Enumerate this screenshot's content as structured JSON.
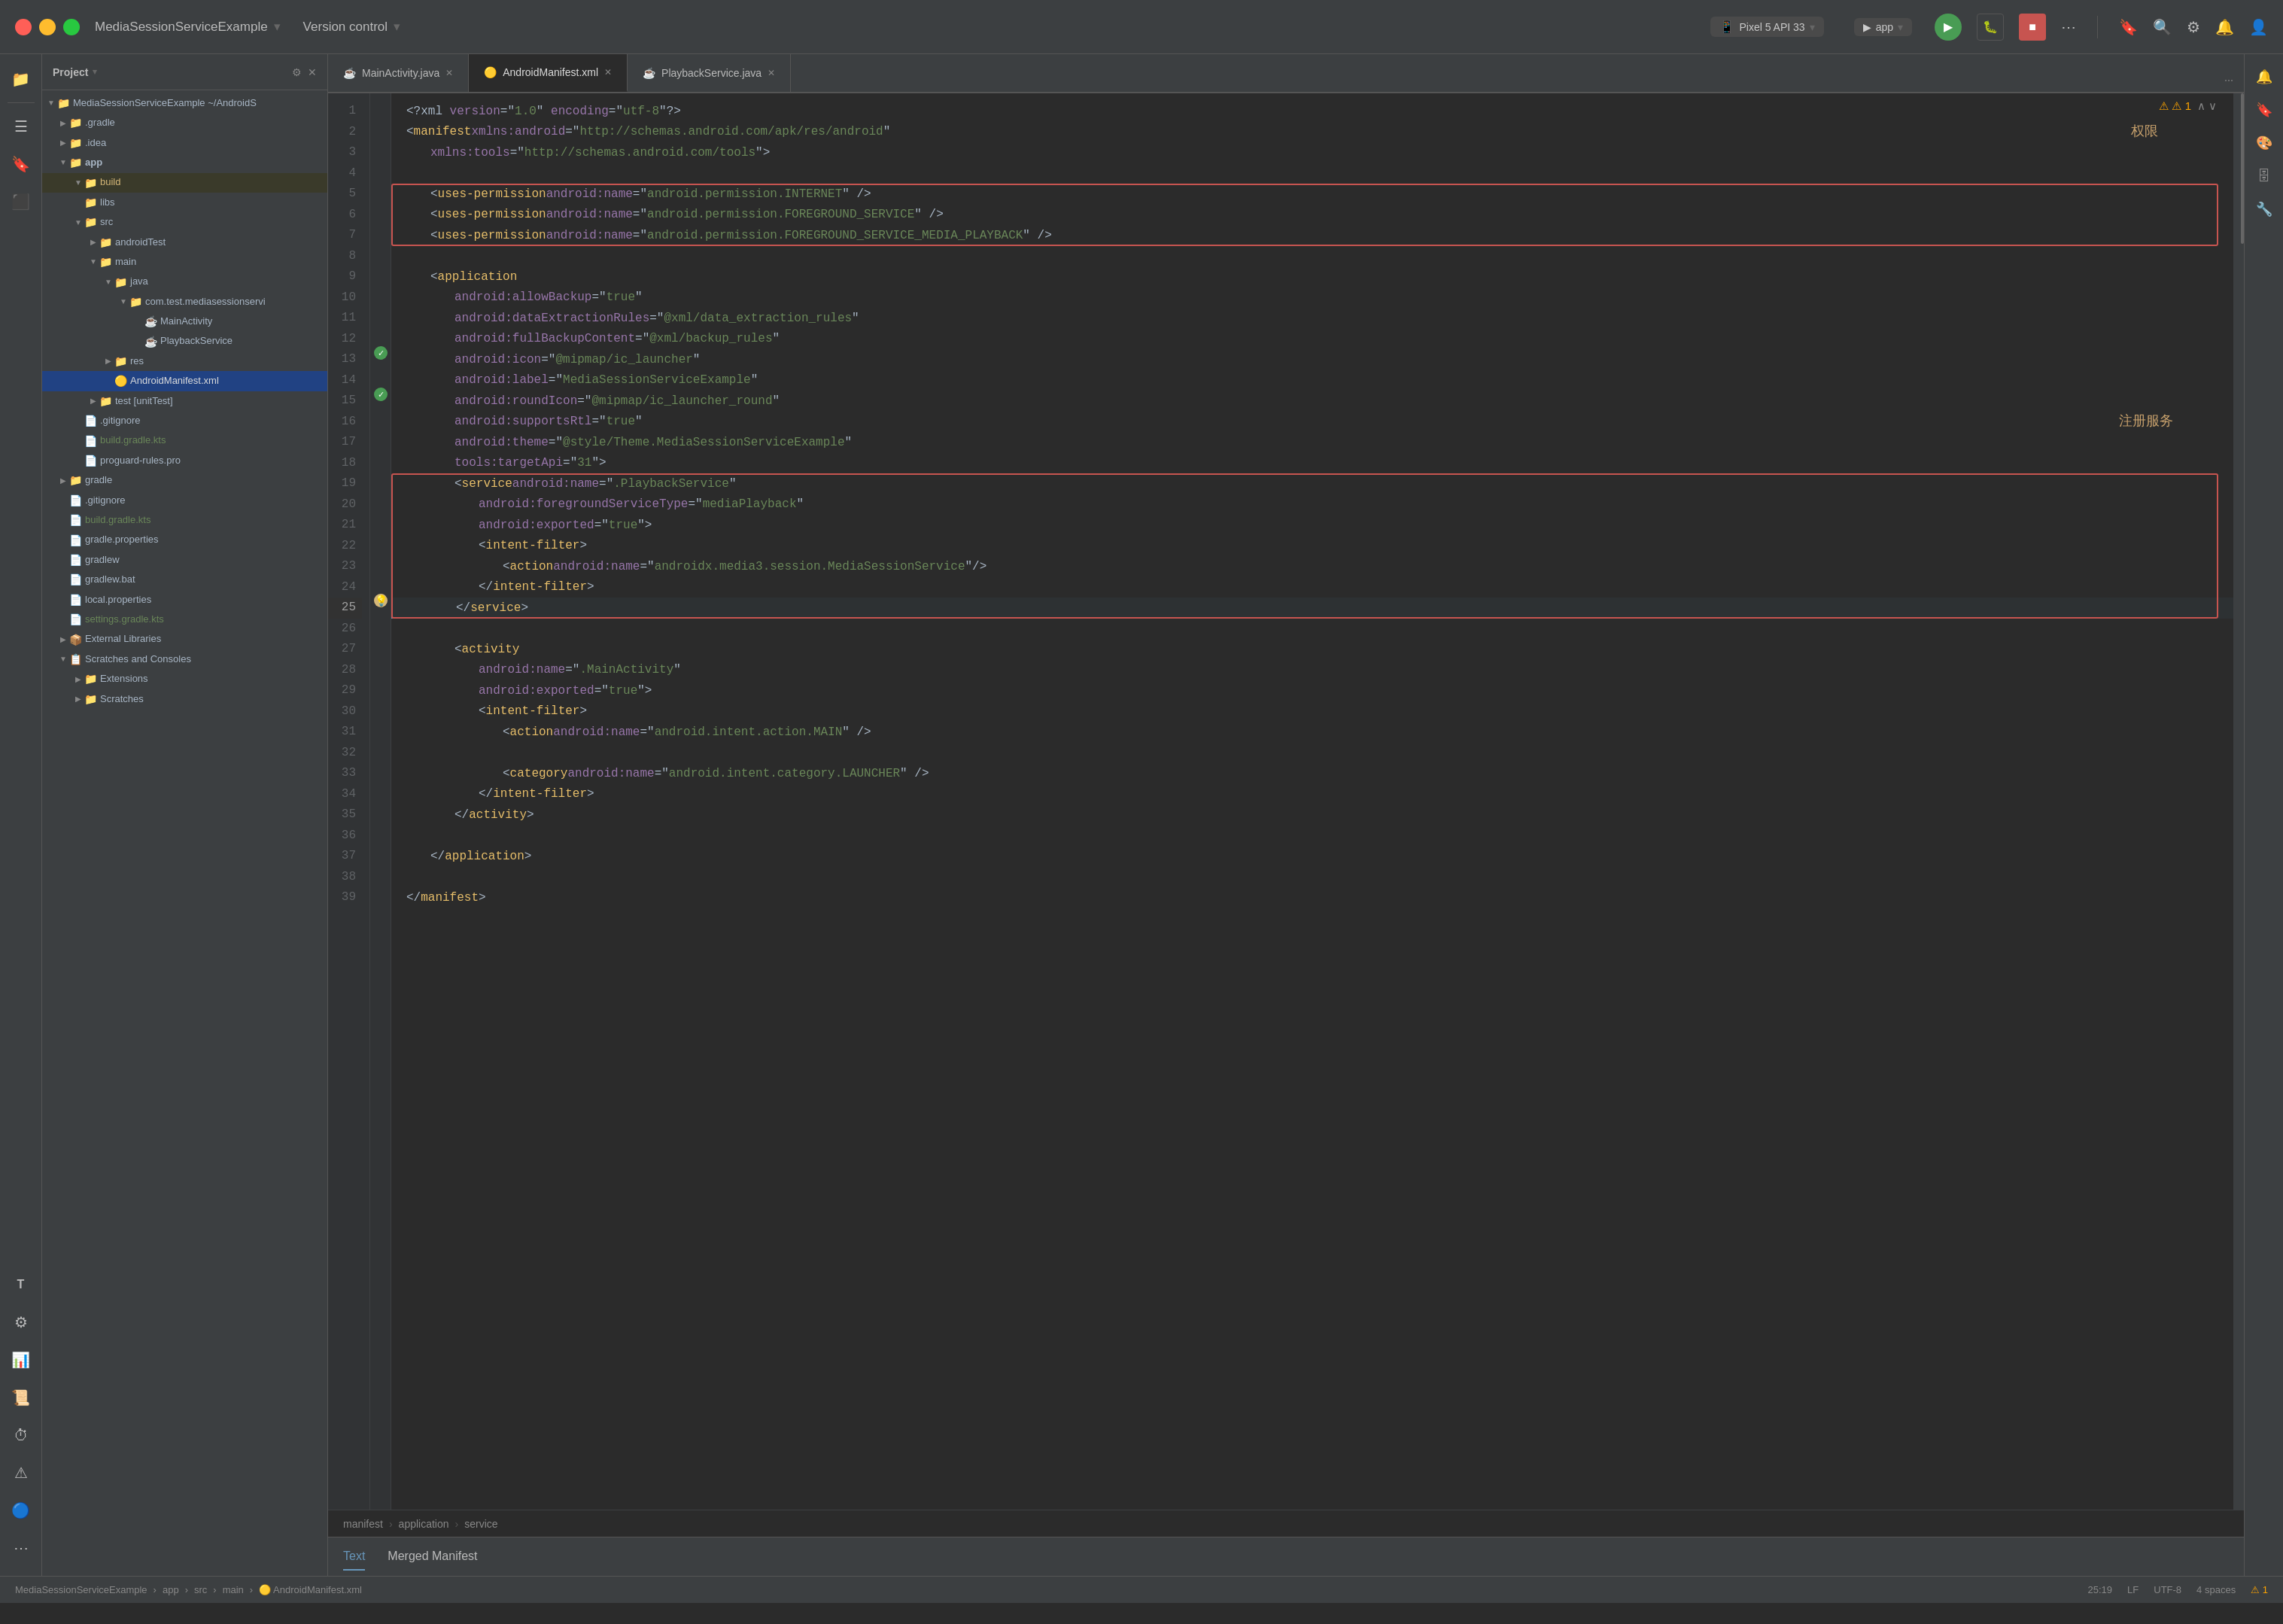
{
  "titlebar": {
    "traffic_lights": [
      "close",
      "minimize",
      "maximize"
    ],
    "app_name": "MediaSessionServiceExample",
    "version_control": "Version control",
    "device": "Pixel 5 API 33",
    "run_config": "app",
    "more_icon": "⋯"
  },
  "tabs": [
    {
      "label": "MainActivity.java",
      "icon": "☕",
      "active": false,
      "closeable": true
    },
    {
      "label": "AndroidManifest.xml",
      "icon": "📄",
      "active": true,
      "closeable": true
    },
    {
      "label": "PlaybackService.java",
      "icon": "☕",
      "active": false,
      "closeable": true
    }
  ],
  "breadcrumbs": [
    "manifest",
    "application",
    "service"
  ],
  "bottom_tabs": [
    {
      "label": "Text",
      "active": true
    },
    {
      "label": "Merged Manifest",
      "active": false
    }
  ],
  "status_bar": {
    "project": "MediaSessionServiceExample",
    "path": "app › src › main › AndroidManifest.xml",
    "line_col": "25:19",
    "line_ending": "LF",
    "encoding": "UTF-8",
    "indent": "4 spaces",
    "warning": "⚠ 1"
  },
  "tree": {
    "root_label": "MediaSessionServiceExample ~/AndroidS",
    "items": [
      {
        "indent": 1,
        "arrow": "▶",
        "icon": "📁",
        "label": ".gradle",
        "color": "normal"
      },
      {
        "indent": 1,
        "arrow": "▶",
        "icon": "📁",
        "label": ".idea",
        "color": "normal"
      },
      {
        "indent": 1,
        "arrow": "▼",
        "icon": "📁",
        "label": "app",
        "color": "normal"
      },
      {
        "indent": 2,
        "arrow": "▼",
        "icon": "📁",
        "label": "build",
        "color": "normal",
        "highlight": true
      },
      {
        "indent": 2,
        "arrow": "",
        "icon": "📁",
        "label": "libs",
        "color": "normal"
      },
      {
        "indent": 2,
        "arrow": "▼",
        "icon": "📁",
        "label": "src",
        "color": "normal"
      },
      {
        "indent": 3,
        "arrow": "▶",
        "icon": "📁",
        "label": "androidTest",
        "color": "normal"
      },
      {
        "indent": 3,
        "arrow": "▼",
        "icon": "📁",
        "label": "main",
        "color": "normal"
      },
      {
        "indent": 4,
        "arrow": "▼",
        "icon": "📁",
        "label": "java",
        "color": "normal"
      },
      {
        "indent": 5,
        "arrow": "▼",
        "icon": "📁",
        "label": "com.test.mediasessionservi",
        "color": "normal"
      },
      {
        "indent": 6,
        "arrow": "",
        "icon": "🔵",
        "label": "MainActivity",
        "color": "normal"
      },
      {
        "indent": 6,
        "arrow": "",
        "icon": "🔵",
        "label": "PlaybackService",
        "color": "normal"
      },
      {
        "indent": 4,
        "arrow": "▶",
        "icon": "📁",
        "label": "res",
        "color": "normal"
      },
      {
        "indent": 4,
        "arrow": "",
        "icon": "🟡",
        "label": "AndroidManifest.xml",
        "color": "xml",
        "selected": true
      },
      {
        "indent": 3,
        "arrow": "▶",
        "icon": "📁",
        "label": "test [unitTest]",
        "color": "normal"
      },
      {
        "indent": 2,
        "arrow": "",
        "icon": "📄",
        "label": ".gitignore",
        "color": "normal"
      },
      {
        "indent": 2,
        "arrow": "",
        "icon": "📄",
        "label": "build.gradle.kts",
        "color": "green"
      },
      {
        "indent": 2,
        "arrow": "",
        "icon": "📄",
        "label": "proguard-rules.pro",
        "color": "normal"
      },
      {
        "indent": 1,
        "arrow": "▶",
        "icon": "📁",
        "label": "gradle",
        "color": "normal"
      },
      {
        "indent": 1,
        "arrow": "",
        "icon": "📄",
        "label": ".gitignore",
        "color": "normal"
      },
      {
        "indent": 1,
        "arrow": "",
        "icon": "📄",
        "label": "build.gradle.kts",
        "color": "green"
      },
      {
        "indent": 1,
        "arrow": "",
        "icon": "📄",
        "label": "gradle.properties",
        "color": "normal"
      },
      {
        "indent": 1,
        "arrow": "",
        "icon": "📄",
        "label": "gradlew",
        "color": "normal"
      },
      {
        "indent": 1,
        "arrow": "",
        "icon": "📄",
        "label": "gradlew.bat",
        "color": "normal"
      },
      {
        "indent": 1,
        "arrow": "",
        "icon": "📄",
        "label": "local.properties",
        "color": "normal"
      },
      {
        "indent": 1,
        "arrow": "",
        "icon": "📄",
        "label": "settings.gradle.kts",
        "color": "green"
      },
      {
        "indent": 1,
        "arrow": "▶",
        "icon": "📦",
        "label": "External Libraries",
        "color": "normal"
      },
      {
        "indent": 1,
        "arrow": "▼",
        "icon": "📋",
        "label": "Scratches and Consoles",
        "color": "normal"
      },
      {
        "indent": 2,
        "arrow": "▶",
        "icon": "📁",
        "label": "Extensions",
        "color": "normal"
      },
      {
        "indent": 2,
        "arrow": "▶",
        "icon": "📁",
        "label": "Scratches",
        "color": "normal"
      }
    ]
  },
  "code_lines": [
    {
      "num": 1,
      "content": "<?xml version=\"1.0\" encoding=\"utf-8\"?>"
    },
    {
      "num": 2,
      "content": "<manifest xmlns:android=\"http://schemas.android.com/apk/res/android\""
    },
    {
      "num": 3,
      "content": "    xmlns:tools=\"http://schemas.android.com/tools\">"
    },
    {
      "num": 4,
      "content": ""
    },
    {
      "num": 5,
      "content": "    <uses-permission android:name=\"android.permission.INTERNET\" />"
    },
    {
      "num": 6,
      "content": "    <uses-permission android:name=\"android.permission.FOREGROUND_SERVICE\" />"
    },
    {
      "num": 7,
      "content": "    <uses-permission android:name=\"android.permission.FOREGROUND_SERVICE_MEDIA_PLAYBACK\" />"
    },
    {
      "num": 8,
      "content": ""
    },
    {
      "num": 9,
      "content": "    <application"
    },
    {
      "num": 10,
      "content": "        android:allowBackup=\"true\""
    },
    {
      "num": 11,
      "content": "        android:dataExtractionRules=\"@xml/data_extraction_rules\""
    },
    {
      "num": 12,
      "content": "        android:fullBackupContent=\"@xml/backup_rules\""
    },
    {
      "num": 13,
      "content": "        android:icon=\"@mipmap/ic_launcher\""
    },
    {
      "num": 14,
      "content": "        android:label=\"MediaSessionServiceExample\""
    },
    {
      "num": 15,
      "content": "        android:roundIcon=\"@mipmap/ic_launcher_round\""
    },
    {
      "num": 16,
      "content": "        android:supportsRtl=\"true\""
    },
    {
      "num": 17,
      "content": "        android:theme=\"@style/Theme.MediaSessionServiceExample\""
    },
    {
      "num": 18,
      "content": "        tools:targetApi=\"31\">"
    },
    {
      "num": 19,
      "content": "        <service android:name=\".PlaybackService\""
    },
    {
      "num": 20,
      "content": "            android:foregroundServiceType=\"mediaPlayback\""
    },
    {
      "num": 21,
      "content": "            android:exported=\"true\">"
    },
    {
      "num": 22,
      "content": "            <intent-filter>"
    },
    {
      "num": 23,
      "content": "                <action android:name=\"androidx.media3.session.MediaSessionService\"/>"
    },
    {
      "num": 24,
      "content": "            </intent-filter>"
    },
    {
      "num": 25,
      "content": "        </service>"
    },
    {
      "num": 26,
      "content": ""
    },
    {
      "num": 27,
      "content": "        <activity"
    },
    {
      "num": 28,
      "content": "            android:name=\".MainActivity\""
    },
    {
      "num": 29,
      "content": "            android:exported=\"true\">"
    },
    {
      "num": 30,
      "content": "            <intent-filter>"
    },
    {
      "num": 31,
      "content": "                <action android:name=\"android.intent.action.MAIN\" />"
    },
    {
      "num": 32,
      "content": ""
    },
    {
      "num": 33,
      "content": "                <category android:name=\"android.intent.category.LAUNCHER\" />"
    },
    {
      "num": 34,
      "content": "            </intent-filter>"
    },
    {
      "num": 35,
      "content": "        </activity>"
    },
    {
      "num": 36,
      "content": ""
    },
    {
      "num": 37,
      "content": "    </application>"
    },
    {
      "num": 38,
      "content": ""
    },
    {
      "num": 39,
      "content": "</manifest>"
    }
  ],
  "annotations": {
    "permissions": "权限",
    "register_service": "注册服务"
  },
  "sidebar_left": {
    "icons": [
      "☰",
      "🔍",
      "🔧",
      "📊",
      "⚠",
      "🔵",
      "📱"
    ]
  },
  "sidebar_bottom": {
    "icons": [
      "T",
      "⚙",
      "📈",
      "⏰",
      "🔵",
      "📡"
    ]
  }
}
